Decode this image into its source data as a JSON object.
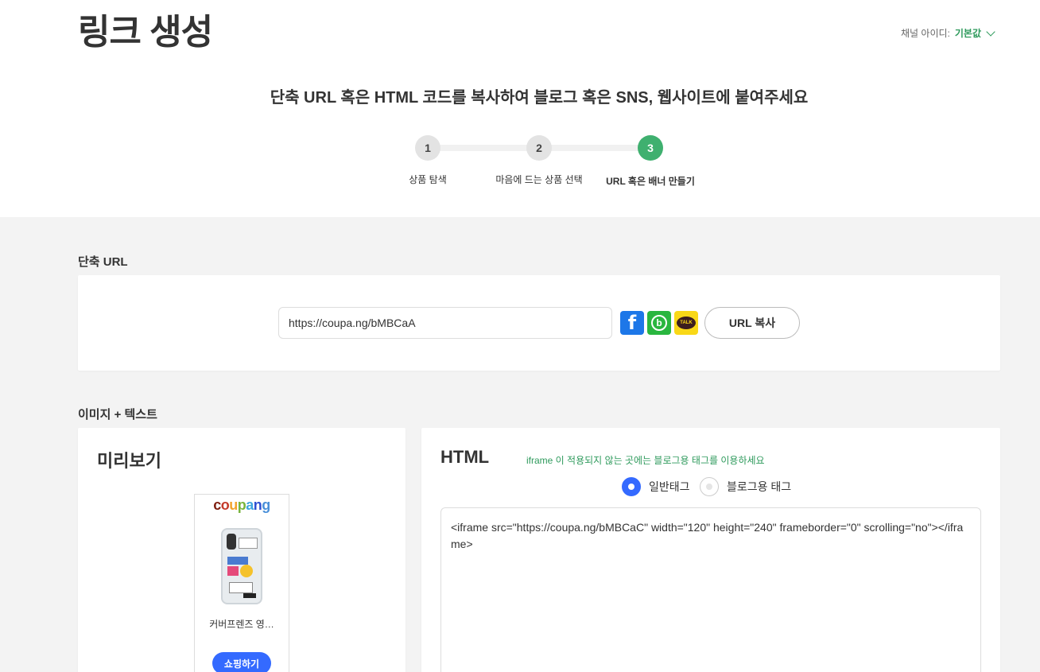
{
  "header": {
    "title": "링크 생성",
    "channel_label": "채널 아이디:",
    "channel_value": "기본값"
  },
  "subtitle": "단축 URL 혹은 HTML 코드를 복사하여 블로그 혹은 SNS, 웹사이트에 붙여주세요",
  "steps": [
    {
      "num": "1",
      "label": "상품 탐색"
    },
    {
      "num": "2",
      "label": "마음에 드는 상품 선택"
    },
    {
      "num": "3",
      "label": "URL 혹은 배너 만들기"
    }
  ],
  "short_url": {
    "section_title": "단축 URL",
    "value": "https://coupa.ng/bMBCaA",
    "copy_label": "URL 복사",
    "sns": {
      "facebook": "f",
      "band": "b",
      "kakao": "TALK"
    }
  },
  "image_text": {
    "section_title": "이미지 + 텍스트",
    "preview": {
      "title": "미리보기",
      "logo": [
        "c",
        "o",
        "u",
        "p",
        "a",
        "n",
        "g"
      ],
      "logo_colors": [
        "#7e1e0f",
        "#c43a2a",
        "#f2a32c",
        "#78b43d",
        "#3ea6e0",
        "#2d4fd1",
        "#4a90d9"
      ],
      "product_name": "커버프렌즈 영…",
      "shop_label": "쇼핑하기"
    },
    "html": {
      "title": "HTML",
      "note": "iframe 이 적용되지 않는 곳에는 블로그용 태그를 이용하세요",
      "radio_normal": "일반태그",
      "radio_blog": "블로그용 태그",
      "selected": "normal",
      "code": "<iframe src=\"https://coupa.ng/bMBCaC\" width=\"120\" height=\"240\" frameborder=\"0\" scrolling=\"no\"></iframe>"
    }
  },
  "colors": {
    "accent_green": "#3fb06f",
    "accent_blue": "#346aff"
  }
}
